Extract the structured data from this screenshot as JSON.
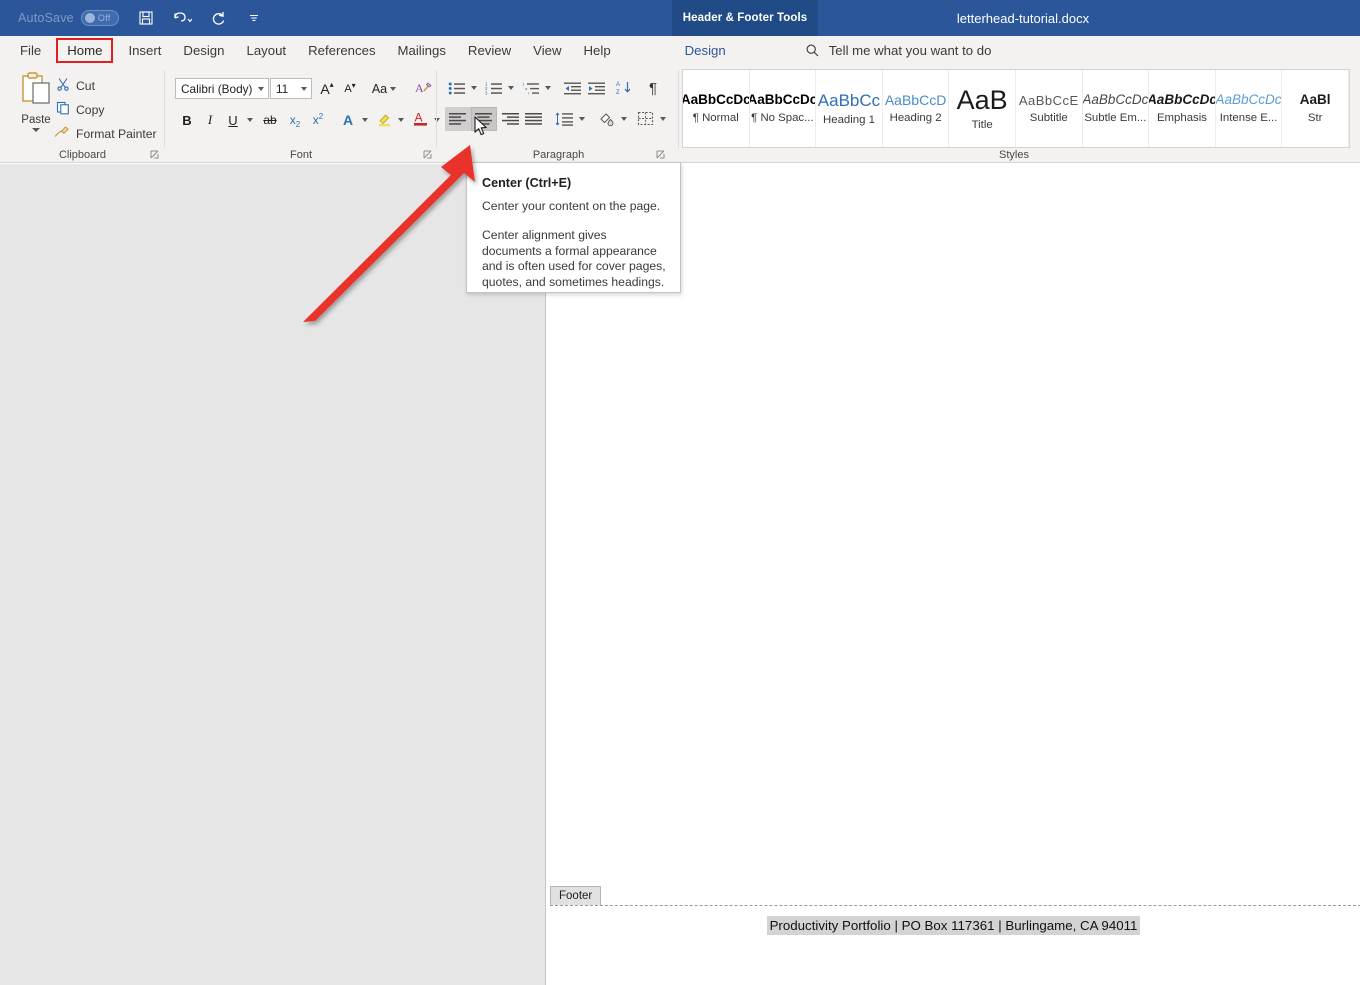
{
  "titlebar": {
    "autosave_label": "AutoSave",
    "autosave_state": "Off",
    "quick_access": [
      {
        "name": "save-icon",
        "label": "Save"
      },
      {
        "name": "undo-icon",
        "label": "Undo"
      },
      {
        "name": "redo-icon",
        "label": "Redo"
      },
      {
        "name": "customize-quick-access-icon",
        "label": "Customize Quick Access Toolbar"
      }
    ],
    "contextual_tab": "Header & Footer Tools",
    "document_title": "letterhead-tutorial.docx",
    "bg_color": "#2b579a",
    "contextual_bg_color": "#204b86"
  },
  "tabs": {
    "items": [
      {
        "label": "File",
        "highlighted": false
      },
      {
        "label": "Home",
        "highlighted": true
      },
      {
        "label": "Insert",
        "highlighted": false
      },
      {
        "label": "Design",
        "highlighted": false
      },
      {
        "label": "Layout",
        "highlighted": false
      },
      {
        "label": "References",
        "highlighted": false
      },
      {
        "label": "Mailings",
        "highlighted": false
      },
      {
        "label": "Review",
        "highlighted": false
      },
      {
        "label": "View",
        "highlighted": false
      },
      {
        "label": "Help",
        "highlighted": false
      }
    ],
    "contextual_design": "Design",
    "highlight_color": "#e02020",
    "tell_me_placeholder": "Tell me what you want to do",
    "search_icon": "search-icon"
  },
  "ribbon": {
    "clipboard": {
      "group_label": "Clipboard",
      "paste_label": "Paste",
      "cut_label": "Cut",
      "copy_label": "Copy",
      "format_painter_label": "Format Painter"
    },
    "font": {
      "group_label": "Font",
      "font_name": "Calibri (Body)",
      "font_size": "11",
      "grow_font": "A",
      "shrink_font": "A",
      "change_case": "Aa",
      "clear_formatting": "clear-formatting-icon",
      "bold": "B",
      "italic": "I",
      "underline": "U",
      "strikethrough": "ab",
      "subscript": "x",
      "superscript": "x",
      "text_effects": "A",
      "highlight": "A",
      "font_color": "A"
    },
    "paragraph": {
      "group_label": "Paragraph",
      "buttons": [
        "bullets-icon",
        "numbering-icon",
        "multilevel-list-icon",
        "decrease-indent-icon",
        "increase-indent-icon",
        "sort-icon",
        "show-formatting-marks-icon",
        "align-left-icon",
        "align-center-icon",
        "align-right-icon",
        "justify-icon",
        "line-spacing-icon",
        "shading-icon",
        "borders-icon"
      ],
      "hovered_button": "align-center-icon"
    },
    "styles": {
      "group_label": "Styles",
      "items": [
        {
          "preview": "AaBbCcDc",
          "name": "¶ Normal"
        },
        {
          "preview": "AaBbCcDc",
          "name": "¶ No Spac..."
        },
        {
          "preview": "AaBbCc",
          "name": "Heading 1"
        },
        {
          "preview": "AaBbCcD",
          "name": "Heading 2"
        },
        {
          "preview": "AaB",
          "name": "Title"
        },
        {
          "preview": "AaBbCcE",
          "name": "Subtitle"
        },
        {
          "preview": "AaBbCcDc",
          "name": "Subtle Em..."
        },
        {
          "preview": "AaBbCcDc",
          "name": "Emphasis"
        },
        {
          "preview": "AaBbCcDc",
          "name": "Intense E..."
        },
        {
          "preview": "AaBl",
          "name": "Str"
        }
      ]
    }
  },
  "tooltip": {
    "title": "Center (Ctrl+E)",
    "subtitle": "Center your content on the page.",
    "body": "Center alignment gives documents a formal appearance and is often used for cover pages, quotes, and sometimes headings."
  },
  "document": {
    "footer_tag_label": "Footer",
    "footer_text": "Productivity Portfolio | PO Box 117361 | Burlingame, CA 94011",
    "footer_text_selected": true
  },
  "annotation": {
    "arrow_color": "#e8312b",
    "arrow_from": "305,320",
    "arrow_to": "478,150",
    "points_at": "align-center-icon"
  }
}
